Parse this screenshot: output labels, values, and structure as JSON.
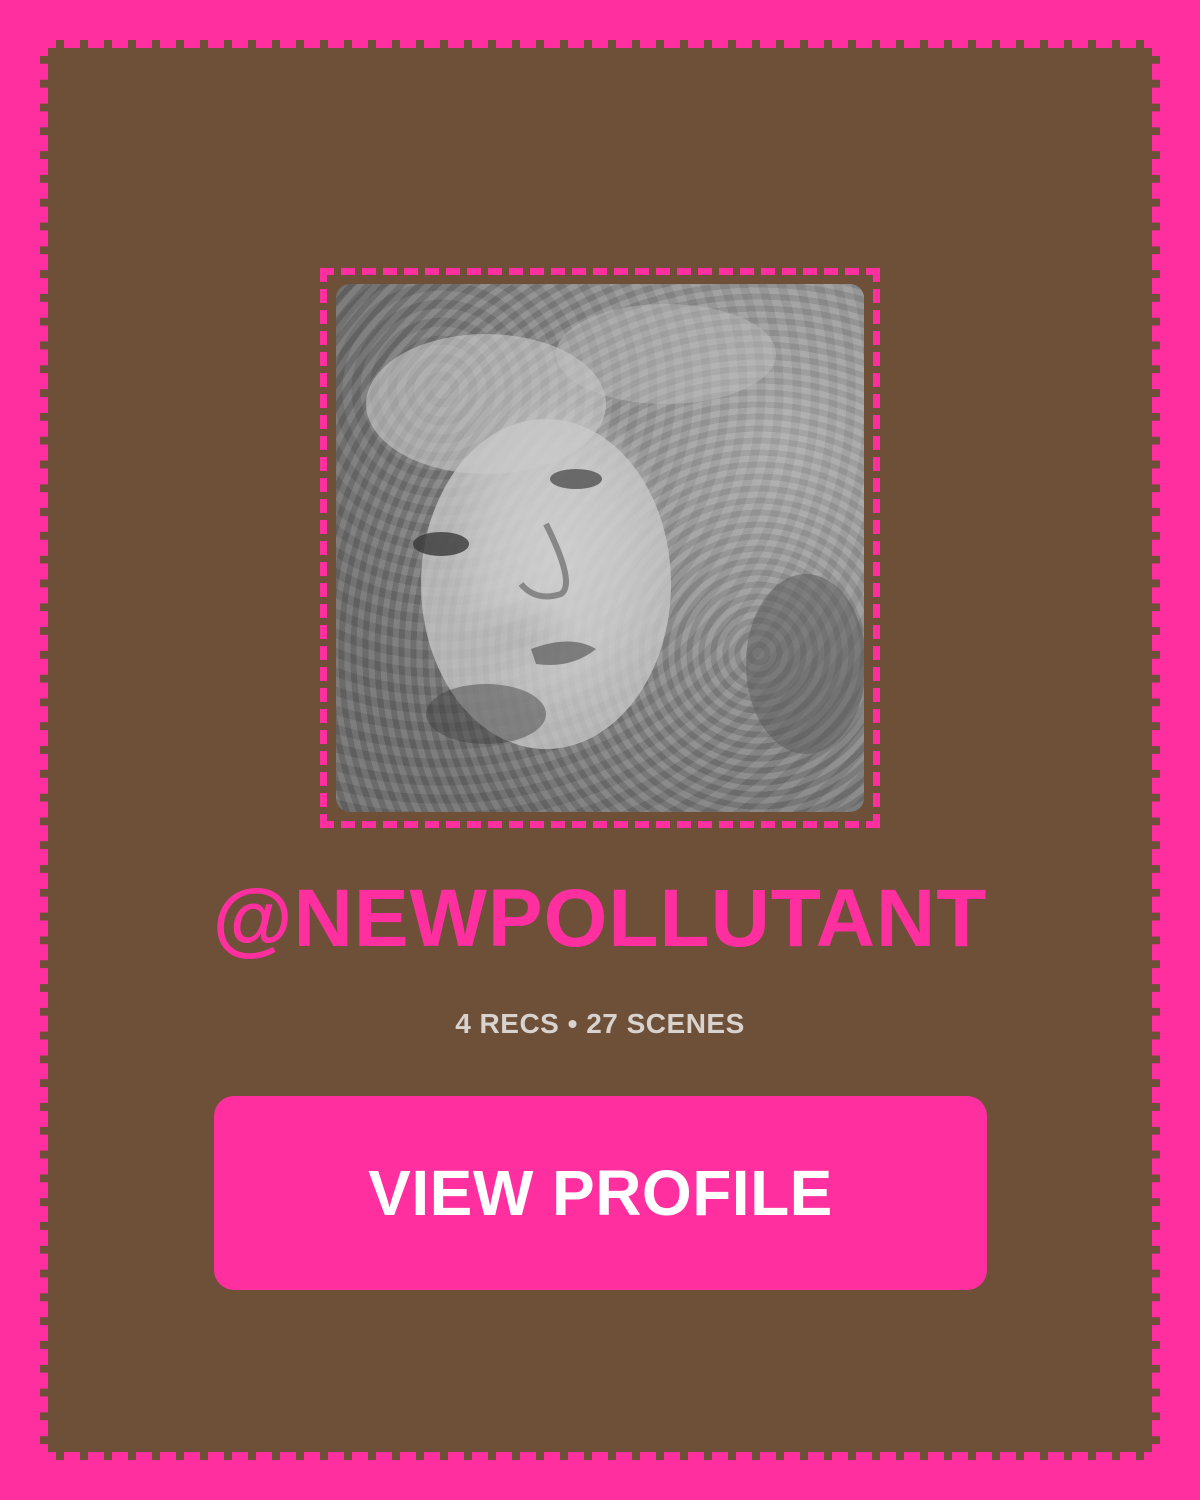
{
  "profile": {
    "handle": "@NEWPOLLUTANT",
    "stats": "4 RECS • 27 SCENES",
    "avatar_description_icon": "profile-photo",
    "view_button_label": "VIEW PROFILE"
  },
  "colors": {
    "background": "#ff2fa0",
    "card": "#6e4f38",
    "accent": "#ff2fa0",
    "stats_text": "#d8d3cf",
    "button_text": "#ffffff"
  }
}
